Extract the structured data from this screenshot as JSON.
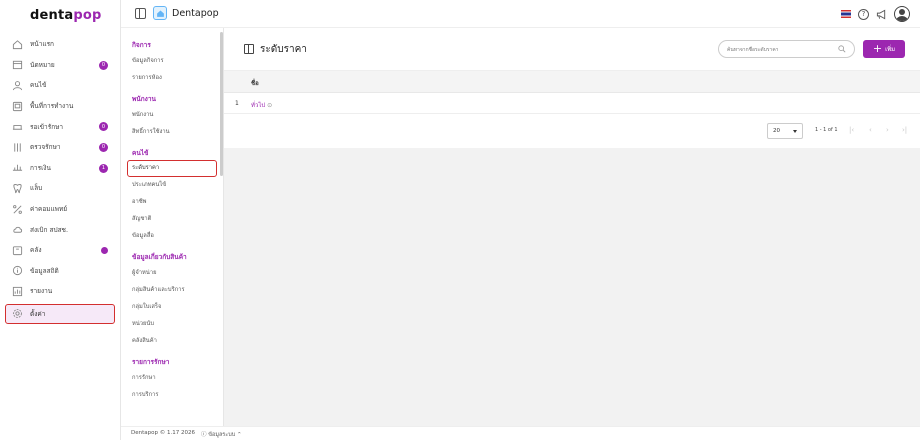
{
  "brand": {
    "part1": "denta",
    "part2": "pop"
  },
  "header": {
    "clinic_name": "Dentapop",
    "language_flag": "thai-flag"
  },
  "sidebar": {
    "items": [
      {
        "label": "หน้าแรก",
        "icon": "home-icon"
      },
      {
        "label": "นัดหมาย",
        "icon": "calendar-icon",
        "badge": "0"
      },
      {
        "label": "คนไข้",
        "icon": "user-icon"
      },
      {
        "label": "พื้นที่การทำงาน",
        "icon": "workspace-icon"
      },
      {
        "label": "รอเข้ารักษา",
        "icon": "chair-icon",
        "badge": "0"
      },
      {
        "label": "ตรวจรักษา",
        "icon": "tools-icon",
        "badge": "0"
      },
      {
        "label": "การเงิน",
        "icon": "money-icon",
        "badge": "1"
      },
      {
        "label": "แล็บ",
        "icon": "tooth-icon"
      },
      {
        "label": "ค่าคอมแพทย์",
        "icon": "percent-icon"
      },
      {
        "label": "ส่งเบิก สปสช.",
        "icon": "cloud-icon"
      },
      {
        "label": "คลัง",
        "icon": "box-icon",
        "dot": true
      },
      {
        "label": "ข้อมูลสถิติ",
        "icon": "info-icon"
      },
      {
        "label": "รายงาน",
        "icon": "report-icon"
      },
      {
        "label": "ตั้งค่า",
        "icon": "gear-icon"
      }
    ]
  },
  "submenu": {
    "groups": [
      {
        "title": "กิจการ",
        "items": [
          "ข้อมูลกิจการ",
          "รายการห้อง"
        ]
      },
      {
        "title": "พนักงาน",
        "items": [
          "พนักงาน",
          "สิทธิ์การใช้งาน"
        ]
      },
      {
        "title": "คนไข้",
        "items": [
          "ระดับราคา",
          "ประเภทคนไข้",
          "อาชีพ",
          "สัญชาติ",
          "ข้อมูลสื่อ"
        ]
      },
      {
        "title": "ข้อมูลเกี่ยวกับสินค้า",
        "items": [
          "ผู้จำหน่าย",
          "กลุ่มสินค้าและบริการ",
          "กลุ่มใบเสร็จ",
          "หน่วยนับ",
          "คลังสินค้า"
        ]
      },
      {
        "title": "รายการรักษา",
        "items": [
          "การรักษา",
          "การบริการ"
        ]
      }
    ]
  },
  "main": {
    "title": "ระดับราคา",
    "search_placeholder": "ค้นหาจากชื่อระดับราคา",
    "add_label": "เพิ่ม",
    "column_name": "ชื่อ",
    "rows": [
      {
        "num": "1",
        "name": "ทั่วไป"
      }
    ],
    "page_size": "20",
    "page_info": "1 - 1 of 1"
  },
  "footer": {
    "copyright": "Dentapop © 1.17 2026",
    "system_info": "ข้อมูลระบบ"
  }
}
